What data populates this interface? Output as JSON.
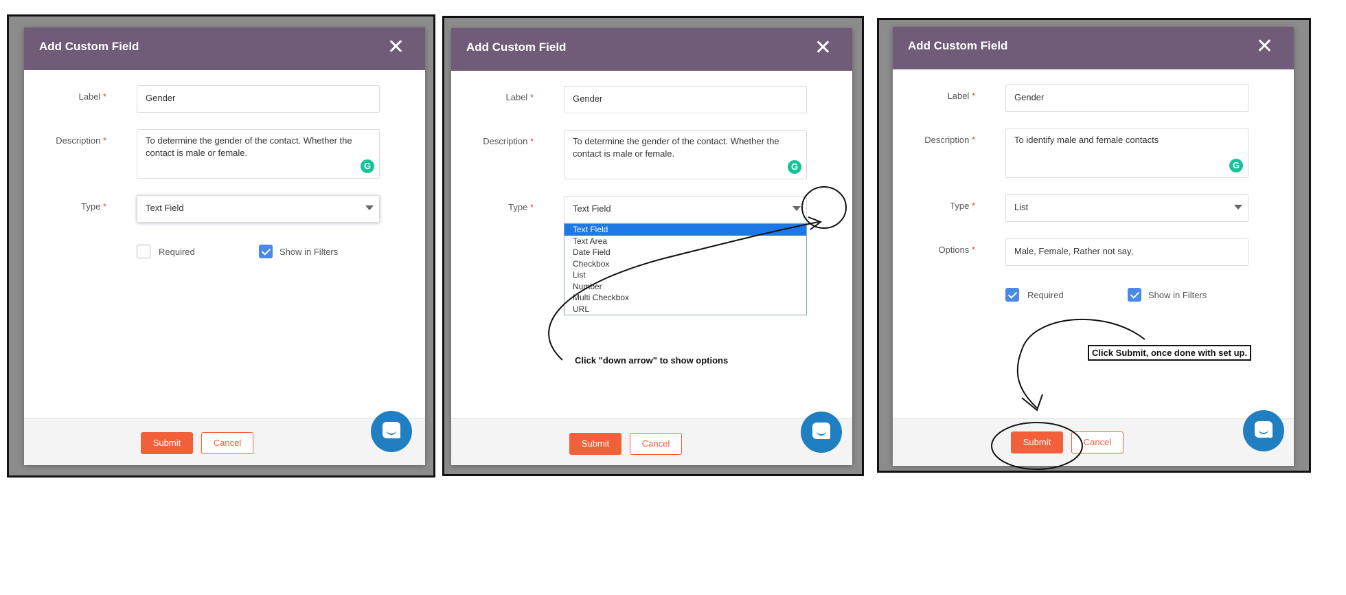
{
  "dialog": {
    "title": "Add Custom Field",
    "close_glyph": "✕",
    "label_label": "Label",
    "description_label": "Description",
    "type_label": "Type",
    "options_label": "Options",
    "required_mark": "*",
    "required_label": "Required",
    "show_in_filters_label": "Show in Filters",
    "submit_label": "Submit",
    "cancel_label": "Cancel",
    "grammarly_glyph": "G"
  },
  "panel1": {
    "label_value": "Gender",
    "description_value": "To determine the gender of the contact. Whether the contact is male or female.",
    "type_value": "Text Field",
    "required_checked": false,
    "show_in_filters_checked": true
  },
  "panel2": {
    "label_value": "Gender",
    "description_value": "To determine the gender of the contact. Whether the contact is male or female.",
    "type_value": "Text Field",
    "type_options": [
      "Text Field",
      "Text Area",
      "Date Field",
      "Checkbox",
      "List",
      "Number",
      "Multi Checkbox",
      "URL"
    ],
    "selected_option": "Text Field",
    "annotation": "Click \"down arrow\" to show options"
  },
  "panel3": {
    "label_value": "Gender",
    "description_value": "To identify male and female contacts",
    "type_value": "List",
    "options_value": "Male, Female, Rather not say,",
    "required_checked": true,
    "show_in_filters_checked": true,
    "annotation": "Click Submit, once done with set up."
  },
  "colors": {
    "header": "#705c78",
    "accent": "#f1603a",
    "checkbox": "#4a89e8",
    "chat": "#1f7fc0",
    "grammarly": "#15c39a"
  }
}
